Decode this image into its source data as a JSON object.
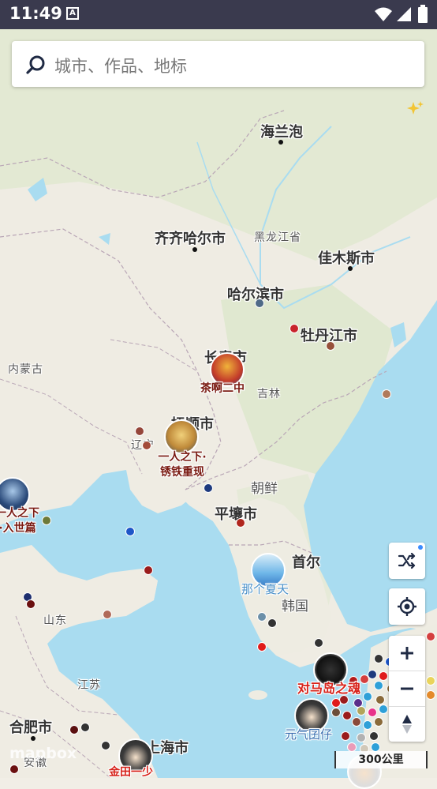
{
  "status": {
    "time": "11:49"
  },
  "search": {
    "placeholder": "城市、作品、地标"
  },
  "map": {
    "cities": [
      "海兰泡",
      "齐齐哈尔市",
      "佳木斯市",
      "哈尔滨市",
      "牡丹江市",
      "长春市",
      "抚顺市",
      "平壤市",
      "首尔",
      "合肥市",
      "上海市"
    ],
    "provinces": [
      "黑龙江省",
      "内蒙古",
      "吉林",
      "辽宁",
      "山东",
      "江苏",
      "安徽",
      "韩国"
    ],
    "countries": [
      "朝鲜"
    ],
    "works": [
      "茶啊二中",
      "一人之下·锈铁重现",
      "那个夏天",
      "对马岛之魂",
      "元气囝仔",
      "金田一少",
      "一人之下·入世篇"
    ],
    "scale": "300公里",
    "logo": "mapbox"
  },
  "controls": [
    "shuffle-button",
    "locate-button",
    "zoom-in-button",
    "zoom-out-button",
    "compass-button"
  ]
}
